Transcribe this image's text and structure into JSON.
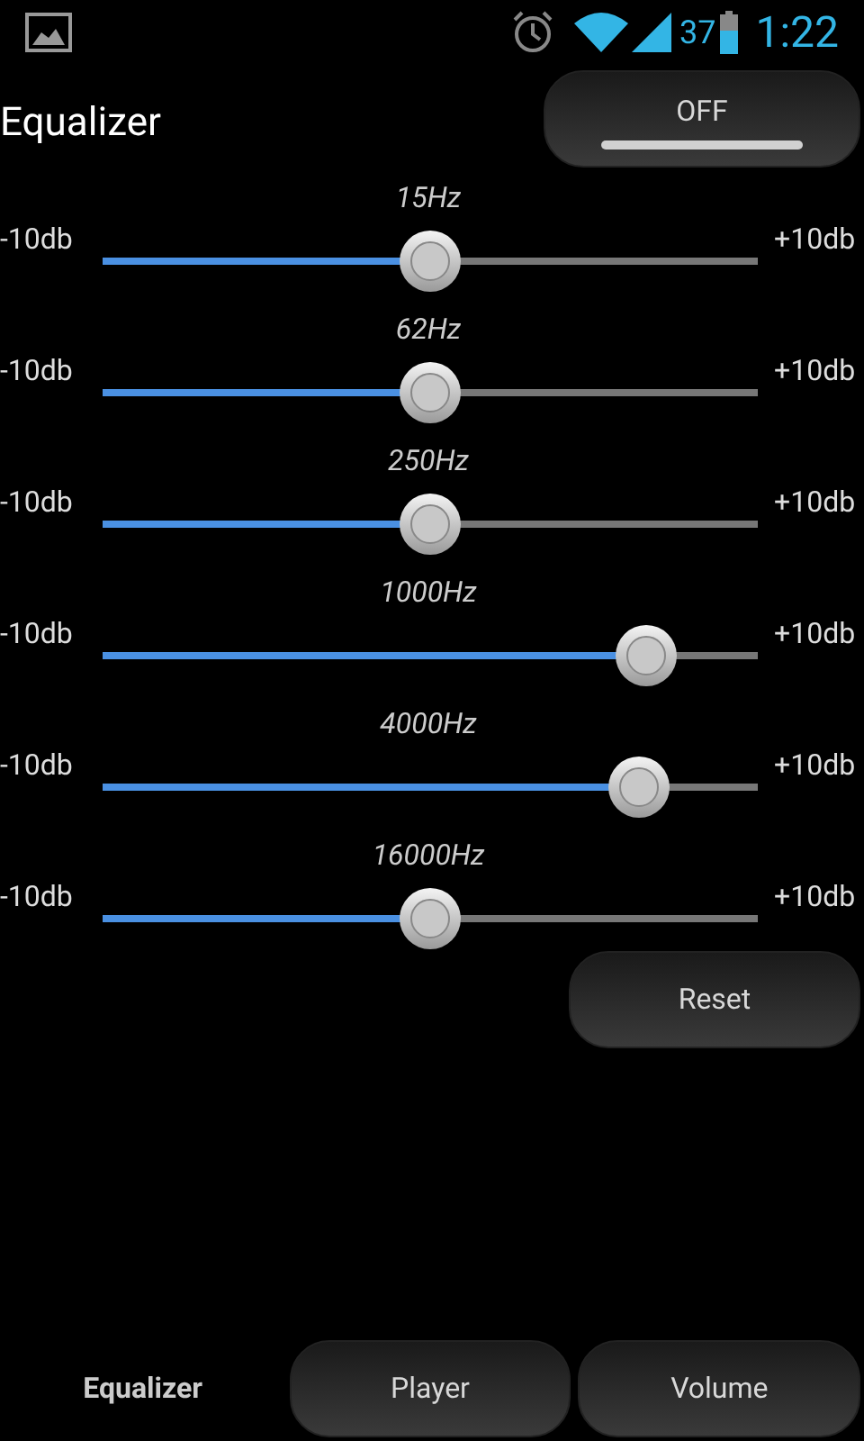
{
  "status_bar": {
    "battery": "37",
    "time": "1:22"
  },
  "header": {
    "title": "Equalizer",
    "toggle": {
      "label": "OFF",
      "on": false
    }
  },
  "bands": [
    {
      "label": "15Hz",
      "min": "-10db",
      "max": "+10db",
      "level": 0.5
    },
    {
      "label": "62Hz",
      "min": "-10db",
      "max": "+10db",
      "level": 0.5
    },
    {
      "label": "250Hz",
      "min": "-10db",
      "max": "+10db",
      "level": 0.5
    },
    {
      "label": "1000Hz",
      "min": "-10db",
      "max": "+10db",
      "level": 0.83
    },
    {
      "label": "4000Hz",
      "min": "-10db",
      "max": "+10db",
      "level": 0.82
    },
    {
      "label": "16000Hz",
      "min": "-10db",
      "max": "+10db",
      "level": 0.5
    }
  ],
  "reset_button": "Reset",
  "tabs": [
    {
      "label": "Equalizer",
      "selected": true
    },
    {
      "label": "Player",
      "selected": false
    },
    {
      "label": "Volume",
      "selected": false
    }
  ]
}
